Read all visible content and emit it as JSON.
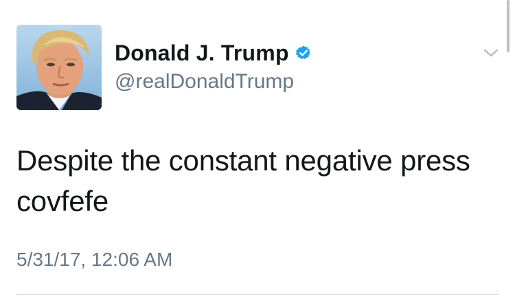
{
  "tweet": {
    "display_name": "Donald J. Trump",
    "handle": "@realDonaldTrump",
    "verified": true,
    "text": "Despite the constant negative press covfefe",
    "timestamp": "5/31/17, 12:06 AM"
  },
  "icons": {
    "verified": "verified-badge-icon",
    "menu": "chevron-down-icon"
  },
  "colors": {
    "primary_text": "#14171a",
    "secondary_text": "#657786",
    "verified_blue": "#1da1f2",
    "divider": "#d6dbe0"
  }
}
